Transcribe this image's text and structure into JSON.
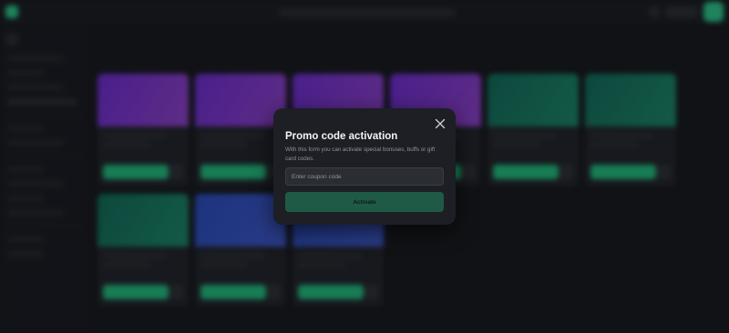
{
  "modal": {
    "title": "Promo code activation",
    "description": "With this form you can activate special bonuses, buffs or gift card codes.",
    "coupon_placeholder": "Enter coupon code",
    "coupon_value": "",
    "activate_label": "Activate",
    "close_icon": "close-icon"
  },
  "colors": {
    "accent_green": "#22d98d",
    "activate_button": "#1f5a46",
    "modal_background": "#1d1f24",
    "page_background": "#15171b"
  },
  "background_cards": [
    {
      "theme": "purple"
    },
    {
      "theme": "purple"
    },
    {
      "theme": "purple"
    },
    {
      "theme": "purple"
    },
    {
      "theme": "teal"
    },
    {
      "theme": "teal"
    },
    {
      "theme": "teal"
    },
    {
      "theme": "blue"
    },
    {
      "theme": "blue"
    }
  ]
}
